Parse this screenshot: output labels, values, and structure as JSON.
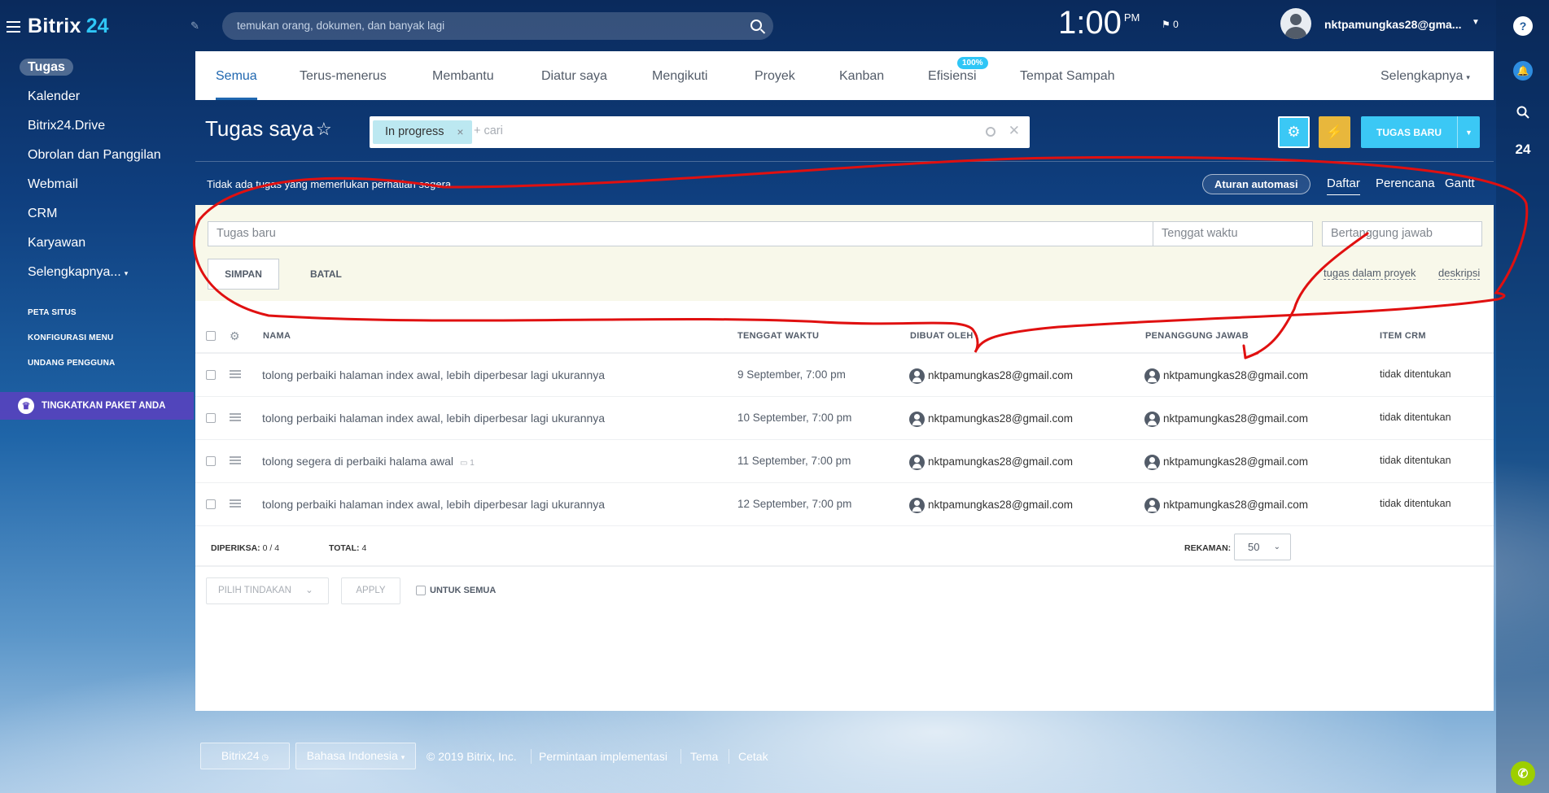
{
  "brand": {
    "name": "Bitrix",
    "num": "24"
  },
  "sidebar": {
    "items": [
      {
        "label": "Tugas"
      },
      {
        "label": "Kalender"
      },
      {
        "label": "Bitrix24.Drive"
      },
      {
        "label": "Obrolan dan Panggilan"
      },
      {
        "label": "Webmail"
      },
      {
        "label": "CRM"
      },
      {
        "label": "Karyawan"
      },
      {
        "label": "Selengkapnya..."
      }
    ],
    "links": [
      "PETA SITUS",
      "KONFIGURASI MENU",
      "UNDANG PENGGUNA"
    ],
    "upgrade": "TINGKATKAN PAKET ANDA"
  },
  "header": {
    "search_placeholder": "temukan orang, dokumen, dan banyak lagi",
    "time": "1:00",
    "ampm": "PM",
    "flag_count": "0",
    "username": "nktpamungkas28@gma..."
  },
  "rail": {
    "help": "?",
    "count": "24"
  },
  "tabs": [
    {
      "label": "Semua",
      "active": true
    },
    {
      "label": "Terus-menerus"
    },
    {
      "label": "Membantu"
    },
    {
      "label": "Diatur saya"
    },
    {
      "label": "Mengikuti"
    },
    {
      "label": "Proyek"
    },
    {
      "label": "Kanban"
    },
    {
      "label": "Efisiensi",
      "badge": "100%"
    },
    {
      "label": "Tempat Sampah"
    },
    {
      "label": "Selengkapnya"
    }
  ],
  "page": {
    "title": "Tugas saya",
    "filter_chip": "In progress",
    "filter_placeholder": "+ cari",
    "new_task_button": "TUGAS BARU",
    "notice": "Tidak ada tugas yang memerlukan perhatian segera",
    "automation_button": "Aturan automasi",
    "views": [
      "Daftar",
      "Perencana",
      "Gantt"
    ]
  },
  "new_task_form": {
    "title_placeholder": "Tugas baru",
    "deadline_placeholder": "Tenggat waktu",
    "responsible_placeholder": "Bertanggung jawab",
    "save": "SIMPAN",
    "cancel": "BATAL",
    "link_project": "tugas dalam proyek",
    "link_description": "deskripsi"
  },
  "table": {
    "columns": [
      "NAMA",
      "TENGGAT WAKTU",
      "DIBUAT OLEH",
      "PENANGGUNG JAWAB",
      "ITEM CRM"
    ],
    "rows": [
      {
        "name": "tolong perbaiki halaman index awal, lebih diperbesar lagi ukurannya",
        "deadline": "9 September, 7:00 pm",
        "creator": "nktpamungkas28@gmail.com",
        "responsible": "nktpamungkas28@gmail.com",
        "crm": "tidak ditentukan",
        "comments": ""
      },
      {
        "name": "tolong perbaiki halaman index awal, lebih diperbesar lagi ukurannya",
        "deadline": "10 September, 7:00 pm",
        "creator": "nktpamungkas28@gmail.com",
        "responsible": "nktpamungkas28@gmail.com",
        "crm": "tidak ditentukan",
        "comments": ""
      },
      {
        "name": "tolong segera di perbaiki halama awal",
        "deadline": "11 September, 7:00 pm",
        "creator": "nktpamungkas28@gmail.com",
        "responsible": "nktpamungkas28@gmail.com",
        "crm": "tidak ditentukan",
        "comments": "1"
      },
      {
        "name": "tolong perbaiki halaman index awal, lebih diperbesar lagi ukurannya",
        "deadline": "12 September, 7:00 pm",
        "creator": "nktpamungkas28@gmail.com",
        "responsible": "nktpamungkas28@gmail.com",
        "crm": "tidak ditentukan",
        "comments": ""
      }
    ],
    "checked_label": "DIPERIKSA:",
    "checked_value": "0 / 4",
    "total_label": "TOTAL:",
    "total_value": "4",
    "records_label": "REKAMAN:",
    "records_value": "50",
    "action_select": "PILIH TINDAKAN",
    "apply": "APPLY",
    "for_all": "UNTUK SEMUA"
  },
  "footer": {
    "logo": "Bitrix24",
    "language": "Bahasa Indonesia",
    "copyright": "© 2019 Bitrix, Inc.",
    "links": [
      "Permintaan implementasi",
      "Tema",
      "Cetak"
    ]
  }
}
